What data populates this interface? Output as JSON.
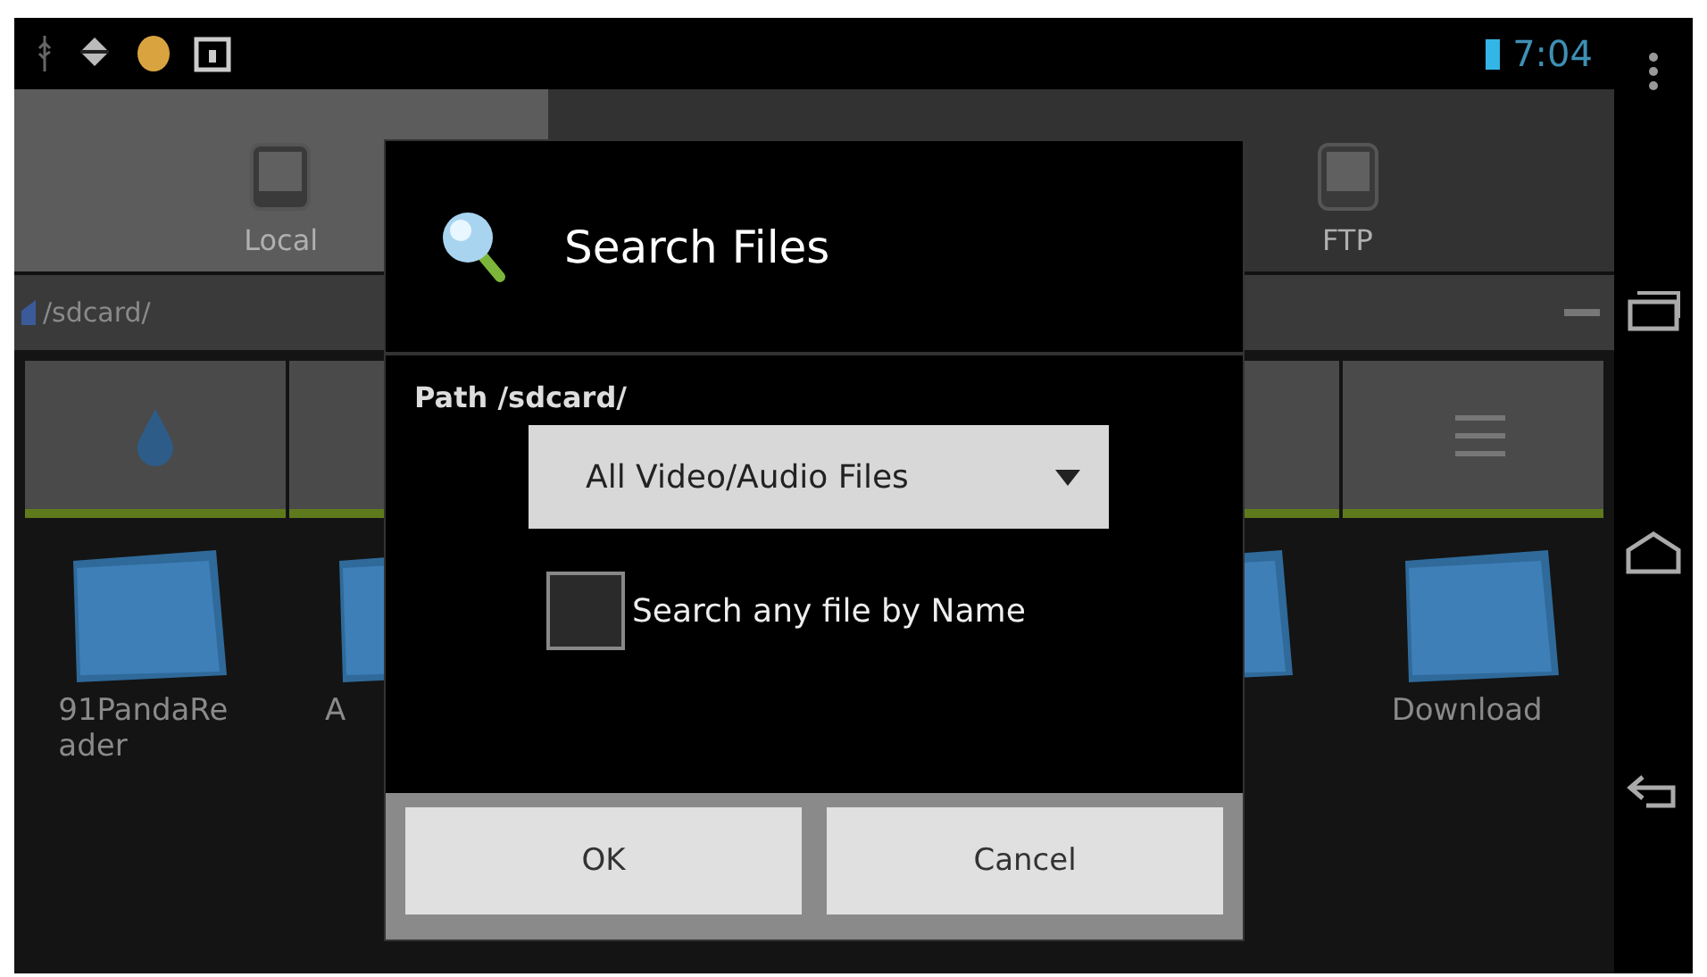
{
  "status_bar": {
    "time": "7:04"
  },
  "tabs": [
    {
      "label": "Local",
      "selected": true
    },
    {
      "selected": false
    },
    {
      "label": "FTP",
      "selected": false
    }
  ],
  "path_bar": {
    "path": "/sdcard/"
  },
  "folders": [
    {
      "name": "91PandaReader"
    },
    {
      "name": "A"
    },
    {
      "name": "Download"
    }
  ],
  "dialog": {
    "title": "Search Files",
    "path_label": "Path /sdcard/",
    "dropdown": {
      "value": "All Video/Audio Files"
    },
    "checkbox": {
      "label": "Search any file by Name",
      "checked": false
    },
    "buttons": [
      "OK",
      "Cancel"
    ]
  }
}
